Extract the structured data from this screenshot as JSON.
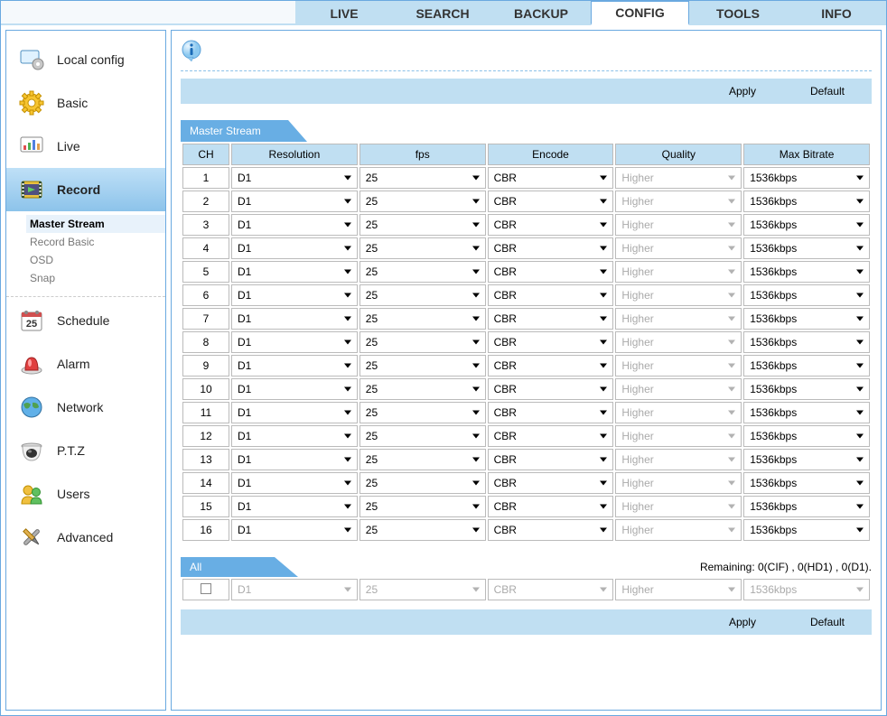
{
  "topnav": [
    "LIVE",
    "SEARCH",
    "BACKUP",
    "CONFIG",
    "TOOLS",
    "INFO"
  ],
  "topnav_active": "CONFIG",
  "sidebar": [
    {
      "id": "local",
      "label": "Local config",
      "icon": "monitor-gear"
    },
    {
      "id": "basic",
      "label": "Basic",
      "icon": "gear"
    },
    {
      "id": "live",
      "label": "Live",
      "icon": "chart-monitor"
    },
    {
      "id": "record",
      "label": "Record",
      "icon": "film"
    },
    {
      "id": "schedule",
      "label": "Schedule",
      "icon": "calendar"
    },
    {
      "id": "alarm",
      "label": "Alarm",
      "icon": "siren"
    },
    {
      "id": "network",
      "label": "Network",
      "icon": "globe"
    },
    {
      "id": "ptz",
      "label": "P.T.Z",
      "icon": "dome"
    },
    {
      "id": "users",
      "label": "Users",
      "icon": "users"
    },
    {
      "id": "advanced",
      "label": "Advanced",
      "icon": "tools"
    }
  ],
  "sidebar_active": "record",
  "record_subitems": [
    "Master Stream",
    "Record Basic",
    "OSD",
    "Snap"
  ],
  "record_subitem_active": "Master Stream",
  "actions": {
    "apply": "Apply",
    "default": "Default"
  },
  "stream_tab": "Master Stream",
  "headers": {
    "ch": "CH",
    "res": "Resolution",
    "fps": "fps",
    "enc": "Encode",
    "qual": "Quality",
    "bit": "Max Bitrate"
  },
  "rows": [
    {
      "ch": "1",
      "res": "D1",
      "fps": "25",
      "enc": "CBR",
      "qual": "Higher",
      "bit": "1536kbps"
    },
    {
      "ch": "2",
      "res": "D1",
      "fps": "25",
      "enc": "CBR",
      "qual": "Higher",
      "bit": "1536kbps"
    },
    {
      "ch": "3",
      "res": "D1",
      "fps": "25",
      "enc": "CBR",
      "qual": "Higher",
      "bit": "1536kbps"
    },
    {
      "ch": "4",
      "res": "D1",
      "fps": "25",
      "enc": "CBR",
      "qual": "Higher",
      "bit": "1536kbps"
    },
    {
      "ch": "5",
      "res": "D1",
      "fps": "25",
      "enc": "CBR",
      "qual": "Higher",
      "bit": "1536kbps"
    },
    {
      "ch": "6",
      "res": "D1",
      "fps": "25",
      "enc": "CBR",
      "qual": "Higher",
      "bit": "1536kbps"
    },
    {
      "ch": "7",
      "res": "D1",
      "fps": "25",
      "enc": "CBR",
      "qual": "Higher",
      "bit": "1536kbps"
    },
    {
      "ch": "8",
      "res": "D1",
      "fps": "25",
      "enc": "CBR",
      "qual": "Higher",
      "bit": "1536kbps"
    },
    {
      "ch": "9",
      "res": "D1",
      "fps": "25",
      "enc": "CBR",
      "qual": "Higher",
      "bit": "1536kbps"
    },
    {
      "ch": "10",
      "res": "D1",
      "fps": "25",
      "enc": "CBR",
      "qual": "Higher",
      "bit": "1536kbps"
    },
    {
      "ch": "11",
      "res": "D1",
      "fps": "25",
      "enc": "CBR",
      "qual": "Higher",
      "bit": "1536kbps"
    },
    {
      "ch": "12",
      "res": "D1",
      "fps": "25",
      "enc": "CBR",
      "qual": "Higher",
      "bit": "1536kbps"
    },
    {
      "ch": "13",
      "res": "D1",
      "fps": "25",
      "enc": "CBR",
      "qual": "Higher",
      "bit": "1536kbps"
    },
    {
      "ch": "14",
      "res": "D1",
      "fps": "25",
      "enc": "CBR",
      "qual": "Higher",
      "bit": "1536kbps"
    },
    {
      "ch": "15",
      "res": "D1",
      "fps": "25",
      "enc": "CBR",
      "qual": "Higher",
      "bit": "1536kbps"
    },
    {
      "ch": "16",
      "res": "D1",
      "fps": "25",
      "enc": "CBR",
      "qual": "Higher",
      "bit": "1536kbps"
    }
  ],
  "all_tab": "All",
  "remaining": "Remaining: 0(CIF) , 0(HD1) , 0(D1).",
  "all_row": {
    "res": "D1",
    "fps": "25",
    "enc": "CBR",
    "qual": "Higher",
    "bit": "1536kbps"
  }
}
